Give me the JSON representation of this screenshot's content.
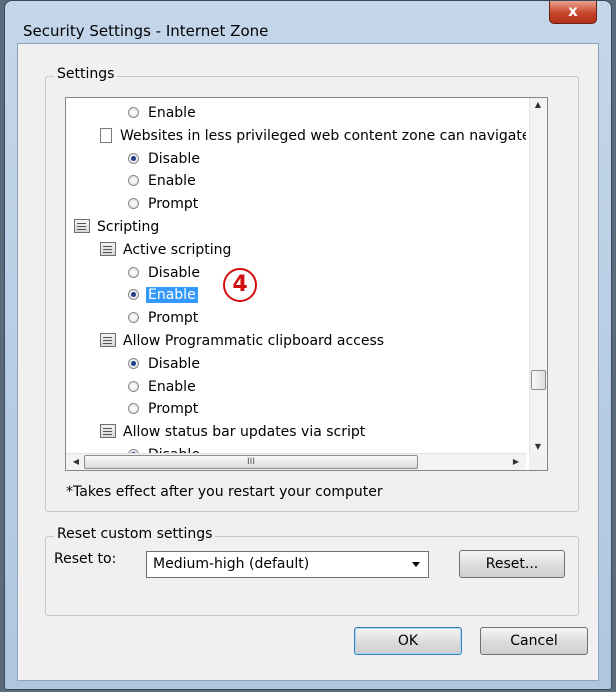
{
  "window": {
    "title": "Security Settings - Internet Zone",
    "close_label": "x"
  },
  "settings": {
    "group_label": "Settings",
    "rows": [
      {
        "kind": "radio",
        "label": "Enable",
        "checked": false,
        "indent": 2
      },
      {
        "kind": "setting",
        "label": "Websites in less privileged web content zone can navigate in",
        "indent": 1
      },
      {
        "kind": "radio",
        "label": "Disable",
        "checked": true,
        "indent": 2
      },
      {
        "kind": "radio",
        "label": "Enable",
        "checked": false,
        "indent": 2
      },
      {
        "kind": "radio",
        "label": "Prompt",
        "checked": false,
        "indent": 2
      },
      {
        "kind": "category",
        "label": "Scripting",
        "indent": 0
      },
      {
        "kind": "script",
        "label": "Active scripting",
        "indent": 1
      },
      {
        "kind": "radio",
        "label": "Disable",
        "checked": false,
        "indent": 2
      },
      {
        "kind": "radio",
        "label": "Enable",
        "checked": true,
        "selected": true,
        "indent": 2
      },
      {
        "kind": "radio",
        "label": "Prompt",
        "checked": false,
        "indent": 2
      },
      {
        "kind": "script",
        "label": "Allow Programmatic clipboard access",
        "indent": 1
      },
      {
        "kind": "radio",
        "label": "Disable",
        "checked": true,
        "indent": 2
      },
      {
        "kind": "radio",
        "label": "Enable",
        "checked": false,
        "indent": 2
      },
      {
        "kind": "radio",
        "label": "Prompt",
        "checked": false,
        "indent": 2
      },
      {
        "kind": "script",
        "label": "Allow status bar updates via script",
        "indent": 1
      },
      {
        "kind": "radio",
        "label": "Disable",
        "checked": true,
        "indent": 2
      }
    ],
    "hscroll_grip": "III",
    "annotation_number": "4"
  },
  "note": "*Takes effect after you restart your computer",
  "reset": {
    "group_label": "Reset custom settings",
    "reset_to_label": "Reset to:",
    "selected_level": "Medium-high (default)",
    "reset_button": "Reset..."
  },
  "footer": {
    "ok": "OK",
    "cancel": "Cancel"
  },
  "colors": {
    "selection": "#3399ff",
    "annotation": "#d01010",
    "close_button": "#c7452a"
  }
}
